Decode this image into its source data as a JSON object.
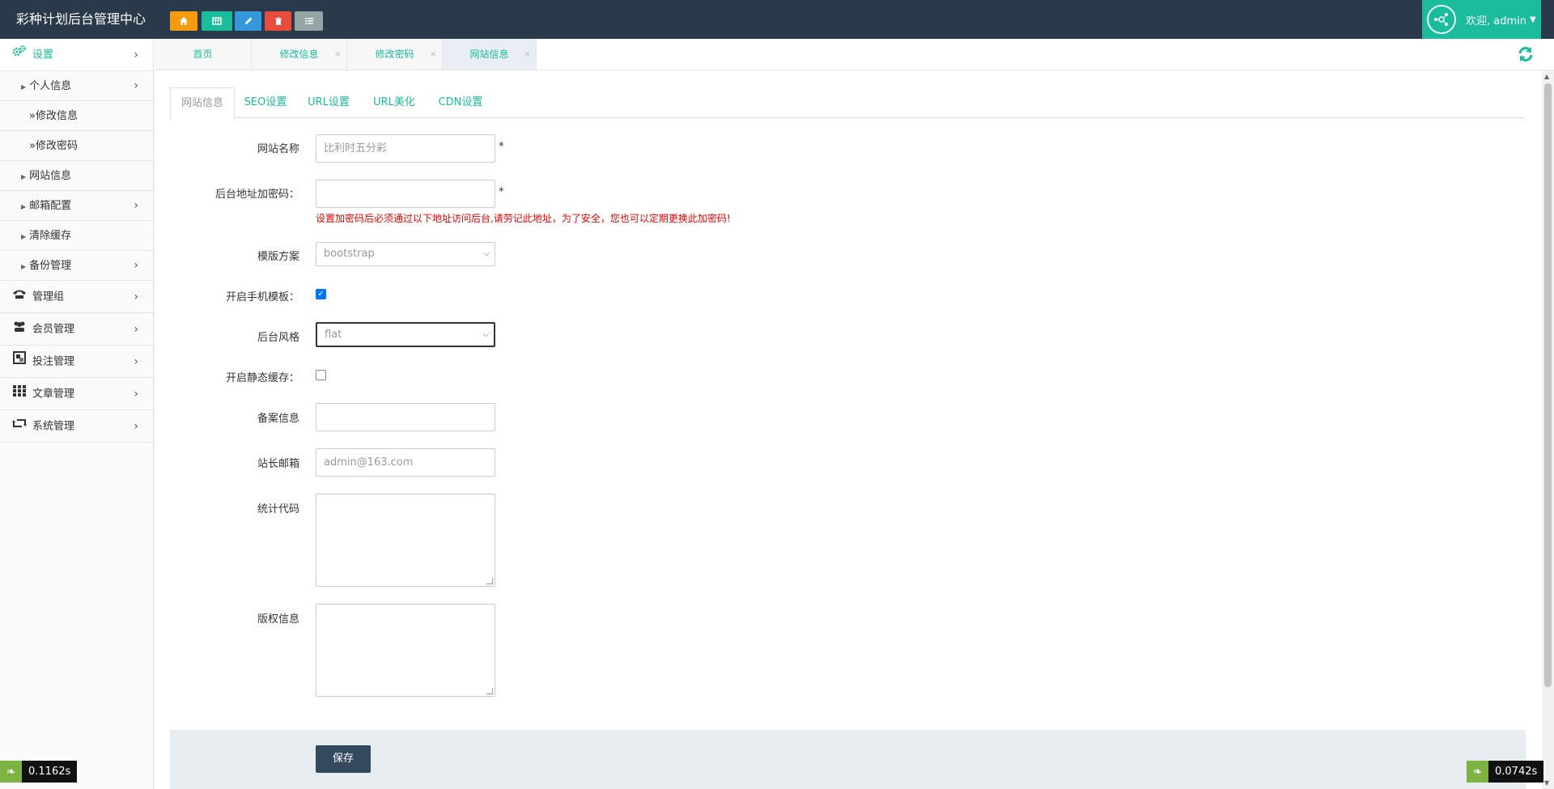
{
  "app": {
    "title": "彩种计划后台管理中心",
    "welcome": "欢迎, admin"
  },
  "sidebar": {
    "items": [
      {
        "label": "设置",
        "icon": "gears-icon"
      },
      {
        "label": "管理组",
        "icon": "phone-icon"
      },
      {
        "label": "会员管理",
        "icon": "users-icon"
      },
      {
        "label": "投注管理",
        "icon": "blocks-icon"
      },
      {
        "label": "文章管理",
        "icon": "grid-icon"
      },
      {
        "label": "系统管理",
        "icon": "retweet-icon"
      }
    ],
    "sub": {
      "personal": "个人信息",
      "edit_info": "»修改信息",
      "edit_pwd": "»修改密码",
      "site_info": "网站信息",
      "mail_config": "邮箱配置",
      "clear_cache": "清除缓存",
      "backup": "备份管理"
    }
  },
  "tabs": [
    {
      "label": "首页"
    },
    {
      "label": "修改信息"
    },
    {
      "label": "修改密码"
    },
    {
      "label": "网站信息"
    }
  ],
  "subtabs": [
    {
      "label": "网站信息"
    },
    {
      "label": "SEO设置"
    },
    {
      "label": "URL设置"
    },
    {
      "label": "URL美化"
    },
    {
      "label": "CDN设置"
    }
  ],
  "form": {
    "site_name_label": "网站名称",
    "site_name_placeholder": "比利时五分彩",
    "admin_pwd_label": "后台地址加密码：",
    "admin_pwd_warning": "设置加密码后必须通过以下地址访问后台,请劳记此地址，为了安全，您也可以定期更换此加密码!",
    "template_label": "模版方案",
    "template_value": "bootstrap",
    "mobile_label": "开启手机模板：",
    "mobile_checked": true,
    "style_label": "后台风格",
    "style_value": "flat",
    "static_cache_label": "开启静态缓存：",
    "static_cache_checked": false,
    "icp_label": "备案信息",
    "email_label": "站长邮箱",
    "email_placeholder": "admin@163.com",
    "stats_label": "统计代码",
    "copyright_label": "版权信息",
    "required_mark": "*",
    "save_label": "保存"
  },
  "timers": {
    "left": "0.1162s",
    "right": "0.0742s"
  },
  "colors": {
    "topbar": "#2b3a4a",
    "accent": "#1abc9c",
    "warning": "#e00000",
    "save_button": "#34495e"
  }
}
